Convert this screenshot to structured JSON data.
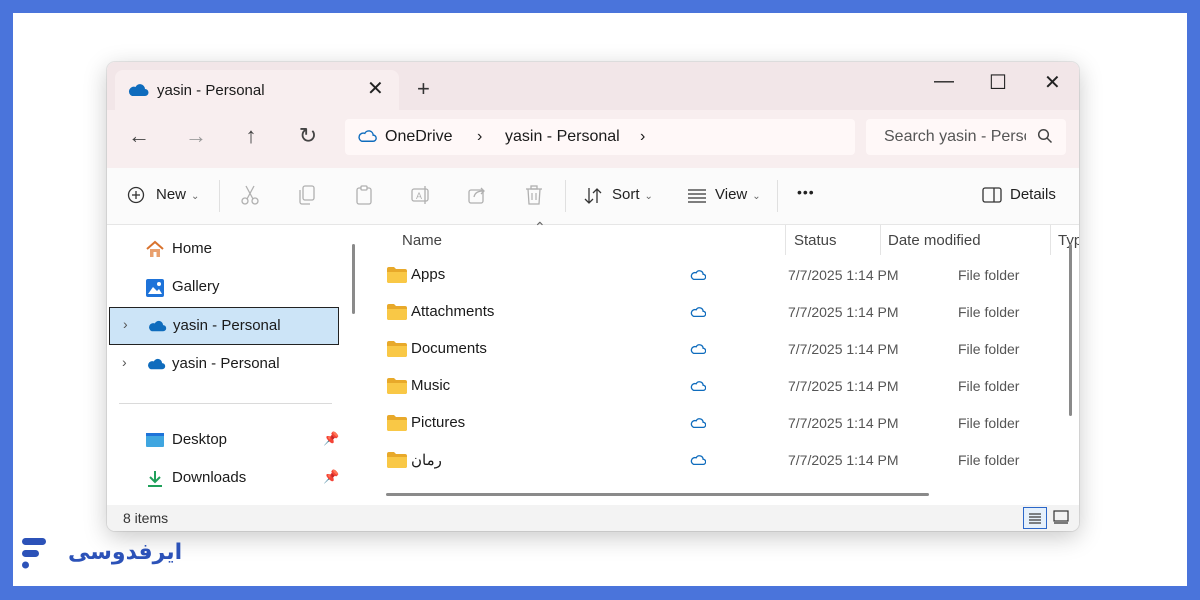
{
  "window": {
    "tab_title": "yasin - Personal",
    "new_tab_symbol": "+",
    "close_tab_symbol": "✕",
    "controls": [
      "—",
      "☐",
      "✕"
    ]
  },
  "nav": {
    "breadcrumb": [
      "OneDrive",
      "yasin - Personal"
    ],
    "separator": "›",
    "search_placeholder": "Search yasin - Personal"
  },
  "toolbar": {
    "new_label": "New",
    "sort_label": "Sort",
    "view_label": "View",
    "more_label": "•••",
    "details_label": "Details",
    "icons": [
      "cut-icon",
      "copy-icon",
      "paste-icon",
      "rename-icon",
      "share-icon",
      "delete-icon"
    ]
  },
  "sidebar": {
    "items": [
      {
        "label": "Home",
        "icon": "home-icon"
      },
      {
        "label": "Gallery",
        "icon": "gallery-icon"
      },
      {
        "label": "yasin - Personal",
        "icon": "onedrive-icon",
        "selected": true,
        "expandable": true
      },
      {
        "label": "yasin - Personal",
        "icon": "onedrive-icon",
        "expandable": true
      },
      {
        "label": "Desktop",
        "icon": "desktop-icon",
        "pinned": true
      },
      {
        "label": "Downloads",
        "icon": "downloads-icon",
        "pinned": true
      }
    ]
  },
  "columns": [
    "Name",
    "Status",
    "Date modified",
    "Type"
  ],
  "files": [
    {
      "name": "Apps",
      "date": "7/7/2025 1:14 PM",
      "type": "File folder"
    },
    {
      "name": "Attachments",
      "date": "7/7/2025 1:14 PM",
      "type": "File folder"
    },
    {
      "name": "Documents",
      "date": "7/7/2025 1:14 PM",
      "type": "File folder"
    },
    {
      "name": "Music",
      "date": "7/7/2025 1:14 PM",
      "type": "File folder"
    },
    {
      "name": "Pictures",
      "date": "7/7/2025 1:14 PM",
      "type": "File folder"
    },
    {
      "name": "رمان",
      "date": "7/7/2025 1:14 PM",
      "type": "File folder"
    }
  ],
  "statusbar": {
    "count": "8 items"
  },
  "brand": {
    "text": "ایرفدوسی"
  },
  "colors": {
    "frame": "#4A74DB",
    "accent": "#0F6CBD",
    "folder": "#F4C542",
    "selected": "#CCE4F7"
  }
}
